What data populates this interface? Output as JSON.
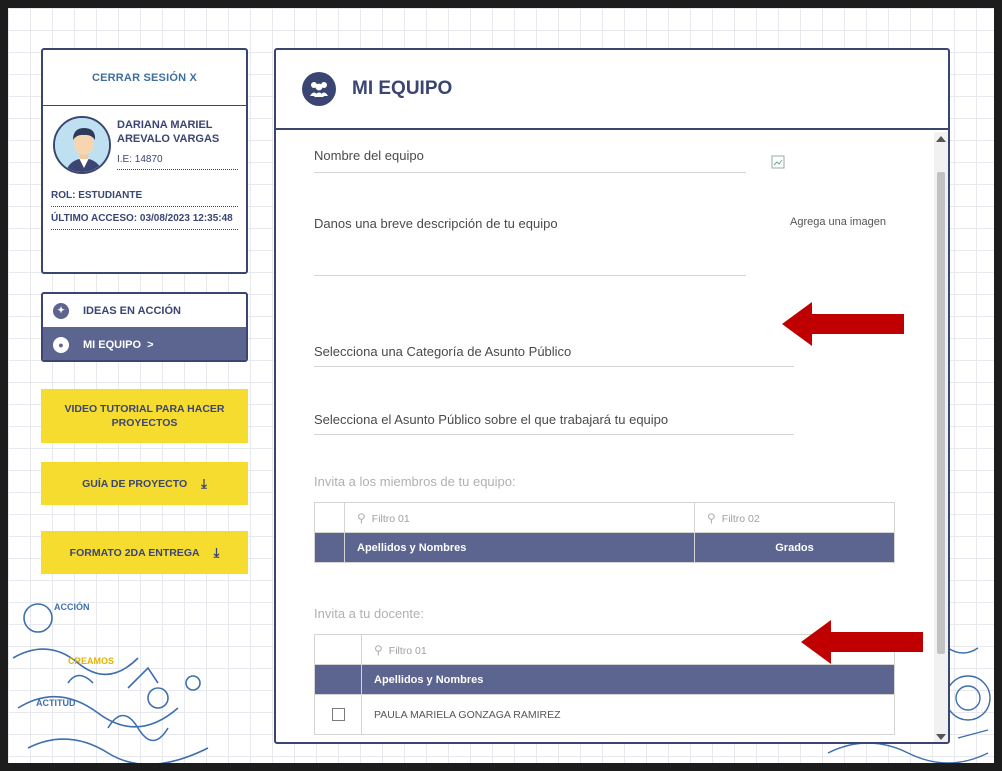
{
  "sidebar": {
    "logout_label": "CERRAR SESIÓN X",
    "user": {
      "name": "DARIANA MARIEL AREVALO VARGAS",
      "school": "I.E: 14870",
      "role": "ROL: ESTUDIANTE",
      "last_access": "ÚLTIMO ACCESO: 03/08/2023 12:35:48"
    },
    "nav_items": [
      {
        "label": "IDEAS EN ACCIÓN",
        "icon": "lightbulb-icon",
        "active": false
      },
      {
        "label": "MI EQUIPO  >",
        "icon": "team-icon",
        "active": true
      }
    ],
    "buttons": {
      "video_tutorial": "VIDEO TUTORIAL PARA HACER PROYECTOS",
      "project_guide": "GUÍA DE PROYECTO",
      "format_2nd": "FORMATO 2DA ENTREGA"
    },
    "doodle_words": [
      "ACCIÓN",
      "CREAMOS",
      "ACTITUD"
    ]
  },
  "main": {
    "title": "MI EQUIPO",
    "team_name_label": "Nombre del equipo",
    "description_label": "Danos una breve descripción de tu equipo",
    "add_image_label": "Agrega una imagen",
    "category_label": "Selecciona una Categoría de Asunto Público",
    "public_issue_label": "Selecciona el Asunto Público sobre el que trabajará tu equipo",
    "invite_members_label": "Invita a los miembros de tu equipo:",
    "members_table": {
      "filter1_placeholder": "Filtro 01",
      "filter2_placeholder": "Filtro 02",
      "col_names": "Apellidos y Nombres",
      "col_grades": "Grados"
    },
    "invite_teacher_label": "Invita a tu docente:",
    "teacher_table": {
      "filter1_placeholder": "Filtro 01",
      "col_names": "Apellidos y Nombres",
      "rows": [
        {
          "name": "PAULA MARIELA GONZAGA RAMIREZ",
          "checked": false
        }
      ]
    }
  },
  "colors": {
    "navy": "#3a4572",
    "header_purple": "#5c6490",
    "yellow": "#f5dc2f",
    "arrow_red": "#c00000"
  }
}
